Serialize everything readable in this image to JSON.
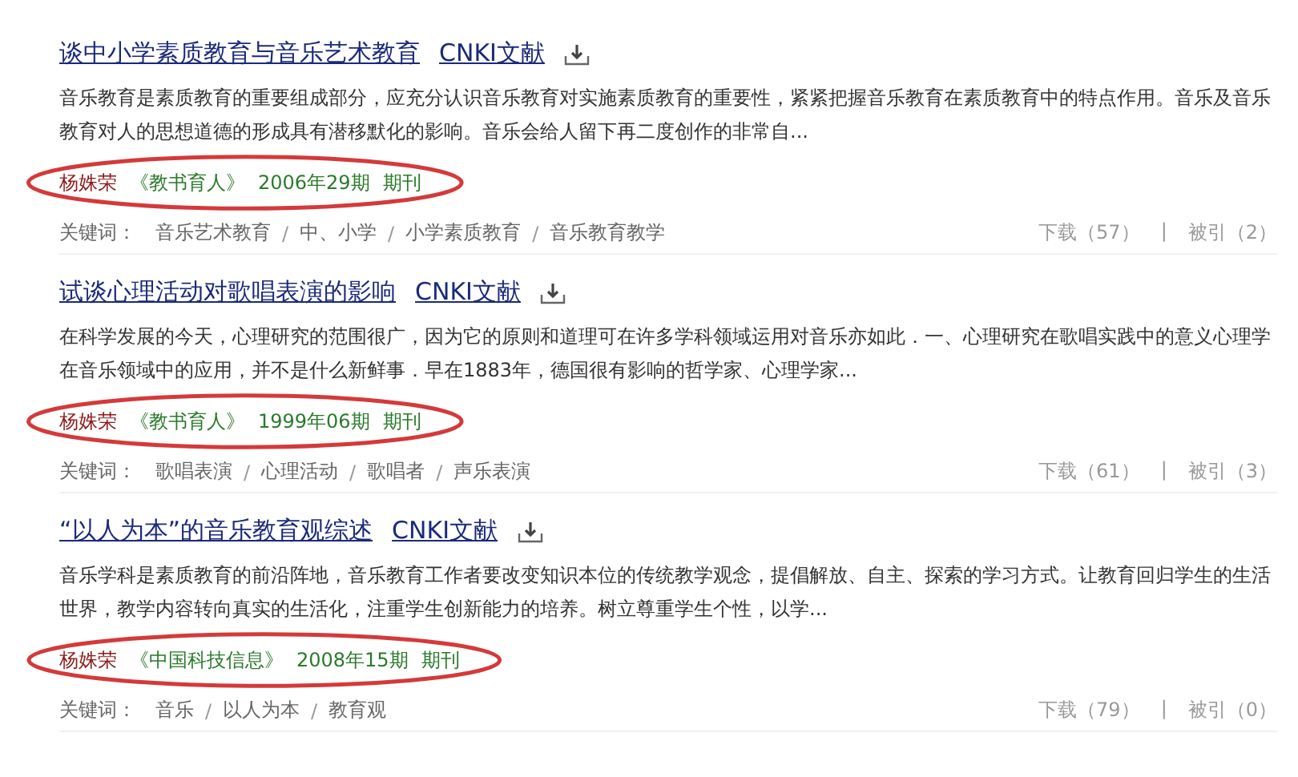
{
  "results": [
    {
      "title": "谈中小学素质教育与音乐艺术教育",
      "source": "CNKI文献",
      "snippet": "音乐教育是素质教育的重要组成部分，应充分认识音乐教育对实施素质教育的重要性，紧紧把握音乐教育在素质教育中的特点作用。音乐及音乐教育对人的思想道德的形成具有潜移默化的影响。音乐会给人留下再二度创作的非常自...",
      "author": "杨姝荣",
      "journal": "《教书育人》",
      "issue": "2006年29期",
      "type": "期刊",
      "circled": true,
      "keywords_label": "关键词：",
      "keywords": [
        "音乐艺术教育",
        "中、小学",
        "小学素质教育",
        "音乐教育教学"
      ],
      "downloads": "下载（57）",
      "stat_separator": "|",
      "citations": "被引（2）",
      "keyword_separator": "/"
    },
    {
      "title": "试谈心理活动对歌唱表演的影响",
      "source": "CNKI文献",
      "snippet": "在科学发展的今天，心理研究的范围很广，因为它的原则和道理可在许多学科领域运用对音乐亦如此．一、心理研究在歌唱实践中的意义心理学在音乐领域中的应用，并不是什么新鲜事．早在1883年，德国很有影响的哲学家、心理学家...",
      "author": "杨姝荣",
      "journal": "《教书育人》",
      "issue": "1999年06期",
      "type": "期刊",
      "circled": true,
      "keywords_label": "关键词：",
      "keywords": [
        "歌唱表演",
        "心理活动",
        "歌唱者",
        "声乐表演"
      ],
      "downloads": "下载（61）",
      "stat_separator": "|",
      "citations": "被引（3）",
      "keyword_separator": "/"
    },
    {
      "title": "“以人为本”的音乐教育观综述",
      "source": "CNKI文献",
      "snippet": "音乐学科是素质教育的前沿阵地，音乐教育工作者要改变知识本位的传统教学观念，提倡解放、自主、探索的学习方式。让教育回归学生的生活世界，教学内容转向真实的生活化，注重学生创新能力的培养。树立尊重学生个性，以学...",
      "author": "杨姝荣",
      "journal": "《中国科技信息》",
      "issue": "2008年15期",
      "type": "期刊",
      "circled": true,
      "keywords_label": "关键词：",
      "keywords": [
        "音乐",
        "以人为本",
        "教育观"
      ],
      "downloads": "下载（79）",
      "stat_separator": "|",
      "citations": "被引（0）",
      "keyword_separator": "/"
    }
  ]
}
